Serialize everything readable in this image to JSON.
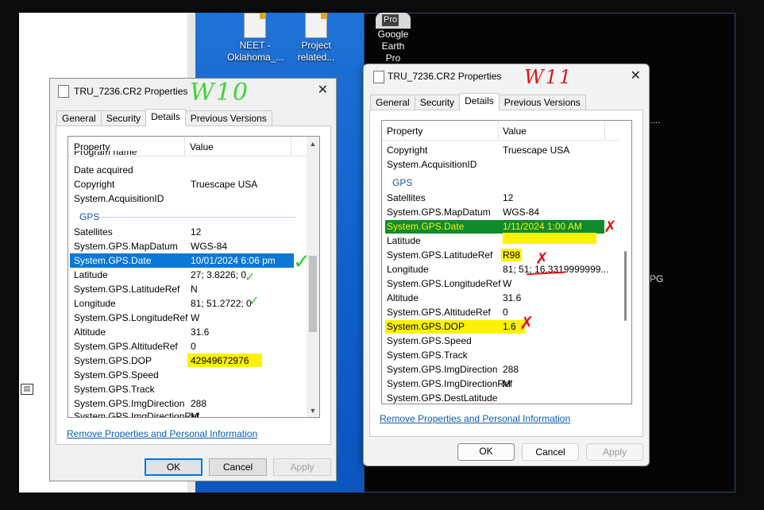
{
  "desktop": {
    "icons": [
      {
        "label_line1": "NEET -",
        "label_line2": "Oklahoma_..."
      },
      {
        "label_line1": "Project",
        "label_line2": "related..."
      }
    ],
    "google_earth": {
      "badge": "Pro",
      "label_line1": "Google Earth",
      "label_line2": "Pro"
    },
    "right_fragments": {
      "dots": "....",
      "pg": "PG"
    }
  },
  "w10": {
    "title": "TRU_7236.CR2 Properties",
    "annotation": "W10",
    "tabs": [
      "General",
      "Security",
      "Details",
      "Previous Versions"
    ],
    "active_tab": "Details",
    "columns": {
      "property": "Property",
      "value": "Value"
    },
    "top_rows": [
      {
        "p": "Program name",
        "v": ""
      },
      {
        "p": "Date acquired",
        "v": ""
      },
      {
        "p": "Copyright",
        "v": "Truescape USA"
      },
      {
        "p": "System.AcquisitionID",
        "v": ""
      }
    ],
    "group": "GPS",
    "gps_rows": [
      {
        "p": "Satellites",
        "v": "12"
      },
      {
        "p": "System.GPS.MapDatum",
        "v": "WGS-84"
      },
      {
        "p": "System.GPS.Date",
        "v": "10/01/2024 6:06 pm"
      },
      {
        "p": "Latitude",
        "v": "27; 3.8226; 0"
      },
      {
        "p": "System.GPS.LatitudeRef",
        "v": "N"
      },
      {
        "p": "Longitude",
        "v": "81; 51.2722; 0"
      },
      {
        "p": "System.GPS.LongitudeRef",
        "v": "W"
      },
      {
        "p": "Altitude",
        "v": "31.6"
      },
      {
        "p": "System.GPS.AltitudeRef",
        "v": "0"
      },
      {
        "p": "System.GPS.DOP",
        "v": "42949672976"
      },
      {
        "p": "System.GPS.Speed",
        "v": ""
      },
      {
        "p": "System.GPS.Track",
        "v": ""
      },
      {
        "p": "System.GPS.ImgDirection",
        "v": "288"
      },
      {
        "p": "System.GPS.ImgDirectionRef",
        "v": "M"
      }
    ],
    "remove_link": "Remove Properties and Personal Information",
    "buttons": {
      "ok": "OK",
      "cancel": "Cancel",
      "apply": "Apply"
    }
  },
  "w11": {
    "title": "TRU_7236.CR2 Properties",
    "annotation": "W11",
    "tabs": [
      "General",
      "Security",
      "Details",
      "Previous Versions"
    ],
    "active_tab": "Details",
    "columns": {
      "property": "Property",
      "value": "Value"
    },
    "top_rows": [
      {
        "p": "Copyright",
        "v": "Truescape USA"
      },
      {
        "p": "System.AcquisitionID",
        "v": ""
      }
    ],
    "group": "GPS",
    "gps_rows": [
      {
        "p": "Satellites",
        "v": "12"
      },
      {
        "p": "System.GPS.MapDatum",
        "v": "WGS-84"
      },
      {
        "p": "System.GPS.Date",
        "v": "1/11/2024 1:00 AM"
      },
      {
        "p": "Latitude",
        "v": ""
      },
      {
        "p": "System.GPS.LatitudeRef",
        "v": "R98"
      },
      {
        "p": "Longitude",
        "v": "81; 51; 16.3319999999..."
      },
      {
        "p": "System.GPS.LongitudeRef",
        "v": "W"
      },
      {
        "p": "Altitude",
        "v": "31.6"
      },
      {
        "p": "System.GPS.AltitudeRef",
        "v": "0"
      },
      {
        "p": "System.GPS.DOP",
        "v": "1.6"
      },
      {
        "p": "System.GPS.Speed",
        "v": ""
      },
      {
        "p": "System.GPS.Track",
        "v": ""
      },
      {
        "p": "System.GPS.ImgDirection",
        "v": "288"
      },
      {
        "p": "System.GPS.ImgDirectionRef",
        "v": "M"
      },
      {
        "p": "System.GPS.DestLatitude",
        "v": ""
      }
    ],
    "remove_link": "Remove Properties and Personal Information",
    "buttons": {
      "ok": "OK",
      "cancel": "Cancel",
      "apply": "Apply"
    }
  },
  "marks": {
    "check": "✓",
    "cross": "✗"
  },
  "colors": {
    "selection_blue": "#0a78d7",
    "highlight_yellow": "#fff200",
    "highlight_green": "#0f8b2e",
    "link": "#0a5db8"
  }
}
